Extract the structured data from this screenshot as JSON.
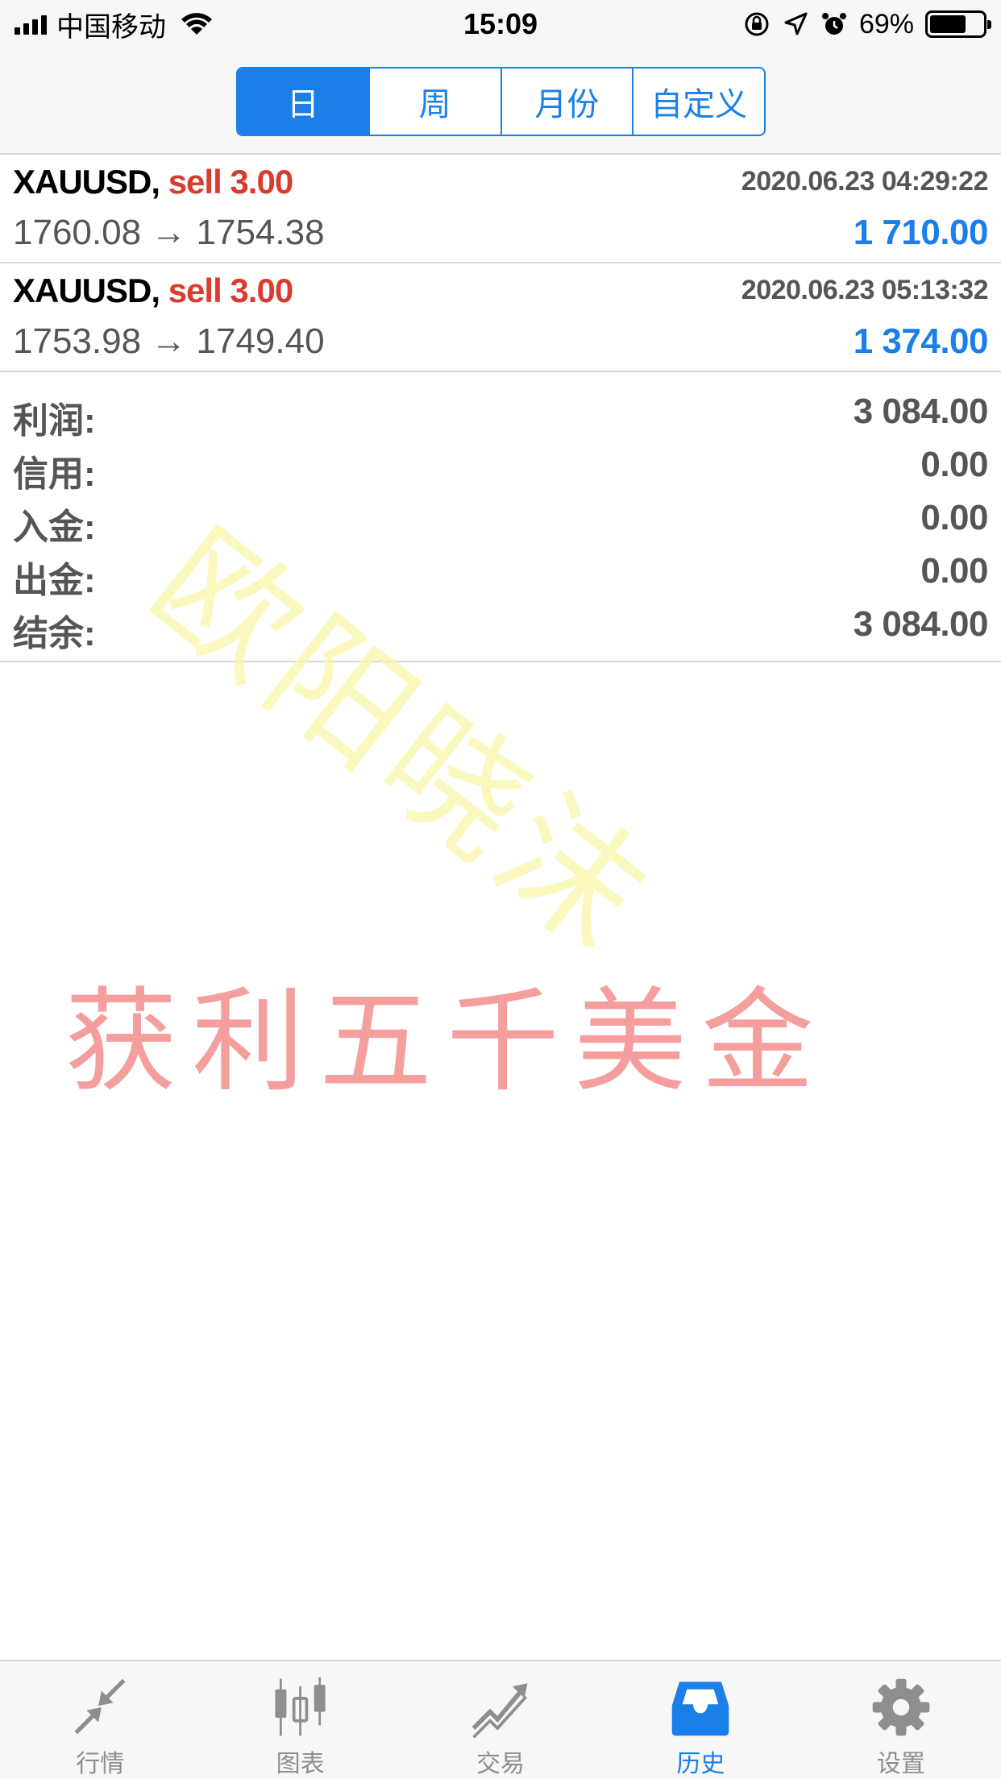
{
  "status_bar": {
    "carrier": "中国移动",
    "time": "15:09",
    "battery_percent": "69%",
    "battery_level": 0.69
  },
  "period_tabs": [
    {
      "label": "日",
      "active": true
    },
    {
      "label": "周",
      "active": false
    },
    {
      "label": "月份",
      "active": false
    },
    {
      "label": "自定义",
      "active": false
    }
  ],
  "deals": [
    {
      "symbol": "XAUUSD,",
      "type": "sell 3.00",
      "time": "2020.06.23 04:29:22",
      "prices": "1760.08 → 1754.38",
      "profit": "1 710.00"
    },
    {
      "symbol": "XAUUSD,",
      "type": "sell 3.00",
      "time": "2020.06.23 05:13:32",
      "prices": "1753.98 → 1749.40",
      "profit": "1 374.00"
    }
  ],
  "summary": [
    {
      "label": "利润:",
      "value": "3 084.00"
    },
    {
      "label": "信用:",
      "value": "0.00"
    },
    {
      "label": "入金:",
      "value": "0.00"
    },
    {
      "label": "出金:",
      "value": "0.00"
    },
    {
      "label": "结余:",
      "value": "3 084.00"
    }
  ],
  "watermarks": {
    "name": "欧阳晓沫",
    "slogan": "获利五千美金"
  },
  "tab_bar": [
    {
      "label": "行情",
      "icon": "quotes-arrows-icon",
      "active": false
    },
    {
      "label": "图表",
      "icon": "candlestick-chart-icon",
      "active": false
    },
    {
      "label": "交易",
      "icon": "trade-trend-icon",
      "active": false
    },
    {
      "label": "历史",
      "icon": "history-inbox-icon",
      "active": true
    },
    {
      "label": "设置",
      "icon": "settings-gear-icon",
      "active": false
    }
  ],
  "colors": {
    "accent": "#1a7fe8",
    "sell": "#d93b2f",
    "text_gray": "#555555",
    "tab_inactive": "#8e8e8e"
  }
}
